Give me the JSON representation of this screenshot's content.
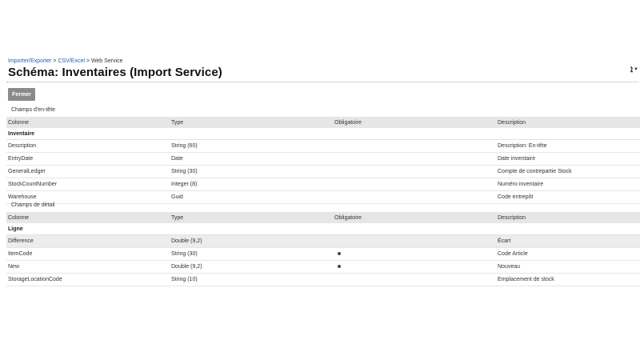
{
  "breadcrumb": {
    "items": [
      "Importer/Exporter",
      "CSV/Excel",
      "Web Service"
    ],
    "separator": ">"
  },
  "title": "Schéma: Inventaires (Import Service)",
  "topright_icon": "language-menu-icon",
  "topright_label": "ܐ",
  "close_button": "Fermer",
  "header_section": {
    "label": "Champs d'en-tête",
    "columns": [
      "Colonne",
      "Type",
      "Obligatoire",
      "Description"
    ],
    "group": "Inventaire",
    "rows": [
      {
        "col": "Description",
        "type": "String (60)",
        "required": false,
        "desc": "Description: En-tête"
      },
      {
        "col": "EntryDate",
        "type": "Date",
        "required": false,
        "desc": "Date inventaire"
      },
      {
        "col": "GeneralLedger",
        "type": "String (30)",
        "required": false,
        "desc": "Compte de contrepartie Stock"
      },
      {
        "col": "StockCountNumber",
        "type": "Integer (8)",
        "required": false,
        "desc": "Numéro inventaire"
      },
      {
        "col": "Warehouse",
        "type": "Guid",
        "required": false,
        "desc": "Code entrepôt"
      }
    ]
  },
  "detail_section": {
    "label": "Champs de détail",
    "columns": [
      "Colonne",
      "Type",
      "Obligatoire",
      "Description"
    ],
    "group": "Ligne",
    "rows": [
      {
        "col": "Difference",
        "type": "Double (9,2)",
        "required": false,
        "desc": "Écart"
      },
      {
        "col": "ItemCode",
        "type": "String (30)",
        "required": true,
        "desc": "Code Article"
      },
      {
        "col": "New",
        "type": "Double (9,2)",
        "required": true,
        "desc": "Nouveau"
      },
      {
        "col": "StorageLocationCode",
        "type": "String (10)",
        "required": false,
        "desc": "Emplacement de stock"
      }
    ]
  }
}
